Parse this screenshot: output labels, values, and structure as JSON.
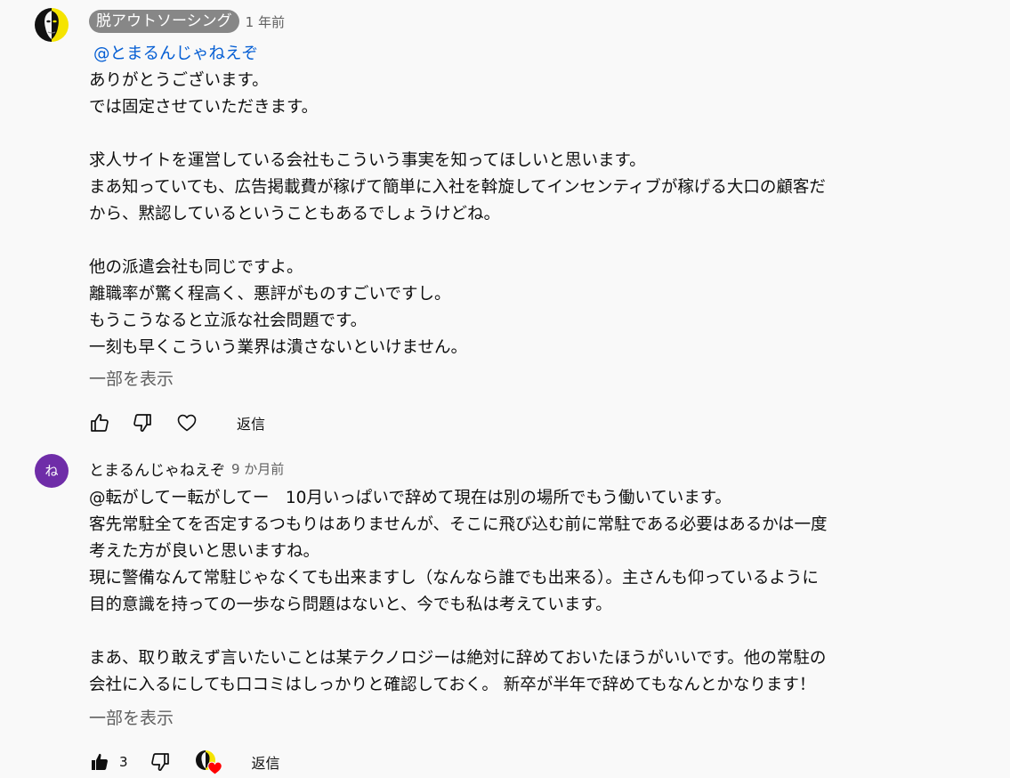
{
  "comments": [
    {
      "author": "脱アウトソーシング",
      "time": "1 年前",
      "mention": "@とまるんじゃねえぞ",
      "lines": [
        "ありがとうございます。",
        "では固定させていただきます。",
        "",
        "求人サイトを運営している会社もこういう事実を知ってほしいと思います。",
        "まあ知っていても、広告掲載費が稼げて簡単に入社を斡旋してインセンティブが稼げる大口の顧客だ",
        "から、黙認しているということもあるでしょうけどね。",
        "",
        "他の派遣会社も同じですよ。",
        "離職率が驚く程高く、悪評がものすごいですし。",
        "もうこうなると立派な社会問題です。",
        "一刻も早くこういう業界は潰さないといけません。"
      ],
      "read_more": "一部を表示",
      "reply": "返信"
    },
    {
      "author": "とまるんじゃねえぞ",
      "avatar_letter": "ね",
      "time": "9 か月前",
      "first_line": " @転がしてー転がしてー　10月いっぱいで辞めて現在は別の場所でもう働いています。",
      "lines": [
        "客先常駐全てを否定するつもりはありませんが、そこに飛び込む前に常駐である必要はあるかは一度",
        "考えた方が良いと思いますね。",
        "現に警備なんて常駐じゃなくても出来ますし（なんなら誰でも出来る）。主さんも仰っているように",
        "目的意識を持っての一歩なら問題はないと、今でも私は考えています。",
        "",
        "まあ、取り敢えず言いたいことは某テクノロジーは絶対に辞めておいたほうがいいです。他の常駐の",
        "会社に入るにしても口コミはしっかりと確認しておく。 新卒が半年で辞めてもなんとかなります！"
      ],
      "read_more": "一部を表示",
      "like_count": "3",
      "reply": "返信"
    }
  ],
  "colors": {
    "background": "#f9f9f9",
    "badge": "#878787",
    "mention": "#065fd4",
    "secondary_text": "#606060",
    "letter_avatar": "#6f2da8",
    "heart": "#ff0000"
  }
}
